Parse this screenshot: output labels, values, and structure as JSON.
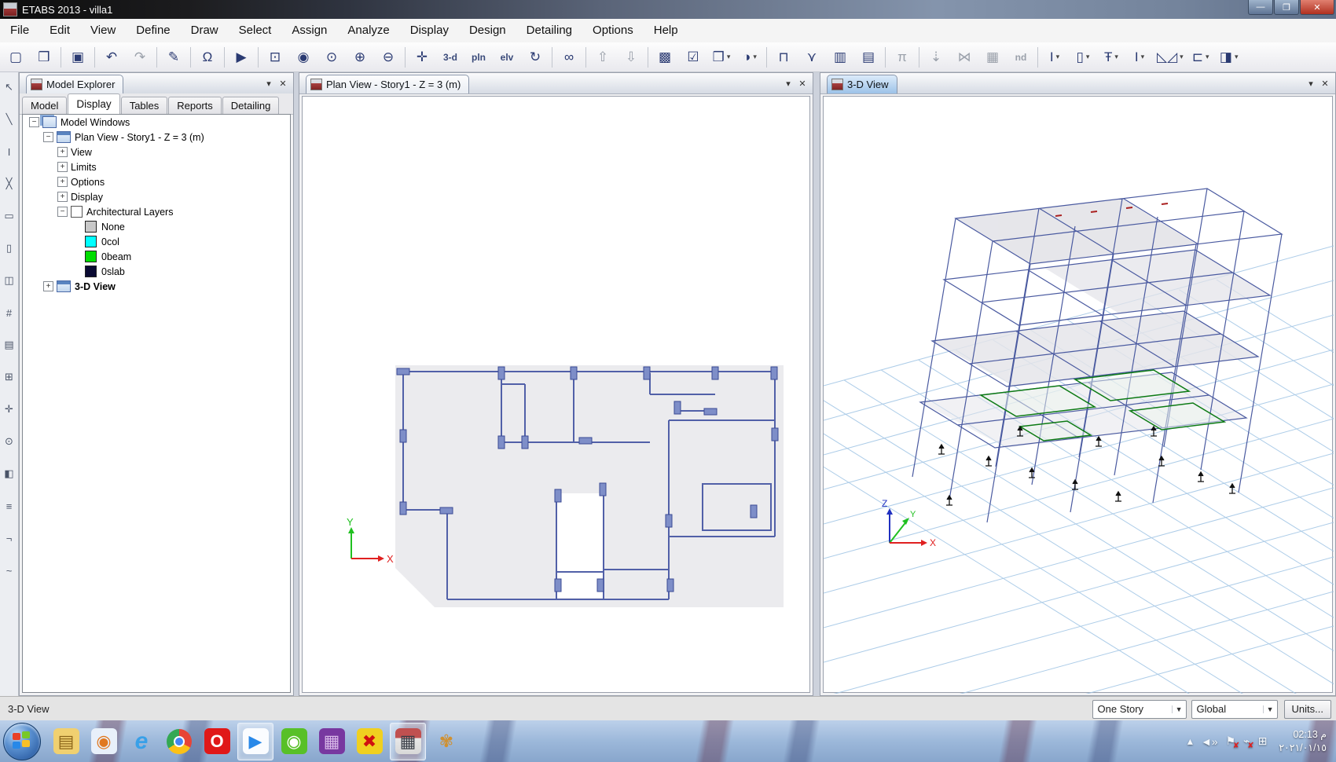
{
  "window": {
    "title": "ETABS 2013  - villa1",
    "controls": {
      "minimize": "—",
      "maximize": "❐",
      "close": "✕"
    }
  },
  "menu": {
    "items": [
      "File",
      "Edit",
      "View",
      "Define",
      "Draw",
      "Select",
      "Assign",
      "Analyze",
      "Display",
      "Design",
      "Detailing",
      "Options",
      "Help"
    ]
  },
  "toolbar": {
    "items": [
      {
        "name": "new-model",
        "glyph": "▢"
      },
      {
        "name": "open-model",
        "glyph": "❒"
      },
      {
        "sep": true
      },
      {
        "name": "save-model",
        "glyph": "▣"
      },
      {
        "sep": true
      },
      {
        "name": "undo",
        "glyph": "↶"
      },
      {
        "name": "redo",
        "glyph": "↷",
        "gray": true
      },
      {
        "sep": true
      },
      {
        "name": "draw-mode",
        "glyph": "✎"
      },
      {
        "sep": true
      },
      {
        "name": "lock-model",
        "glyph": "Ω"
      },
      {
        "sep": true
      },
      {
        "name": "run-analysis",
        "glyph": "▶"
      },
      {
        "sep": true
      },
      {
        "name": "rubber-band-zoom",
        "glyph": "⊡"
      },
      {
        "name": "restore-full-view",
        "glyph": "◉"
      },
      {
        "name": "previous-zoom",
        "glyph": "⊙"
      },
      {
        "name": "zoom-in",
        "glyph": "⊕"
      },
      {
        "name": "zoom-out",
        "glyph": "⊖"
      },
      {
        "sep": true
      },
      {
        "name": "pan-view",
        "glyph": "✛"
      },
      {
        "name": "view-3d",
        "text": "3-d"
      },
      {
        "name": "view-plan",
        "text": "pln"
      },
      {
        "name": "view-elevation",
        "text": "elv"
      },
      {
        "name": "rotate-3d-view",
        "glyph": "↻"
      },
      {
        "sep": true
      },
      {
        "name": "object-view-glasses",
        "glyph": "∞"
      },
      {
        "sep": true
      },
      {
        "name": "move-up-in-list",
        "glyph": "⇧",
        "gray": true
      },
      {
        "name": "move-down-in-list",
        "glyph": "⇩",
        "gray": true
      },
      {
        "sep": true
      },
      {
        "name": "shrink-objects",
        "glyph": "▩"
      },
      {
        "name": "set-display-options",
        "glyph": "☑"
      },
      {
        "name": "object-extrude",
        "glyph": "❒",
        "caret": true
      },
      {
        "name": "object-visibility",
        "glyph": "◑",
        "caret": true
      },
      {
        "sep": true
      },
      {
        "name": "draw-frame-props",
        "glyph": "⊓"
      },
      {
        "name": "snap-options",
        "glyph": "⋎"
      },
      {
        "name": "wall-stack",
        "glyph": "▥"
      },
      {
        "name": "floor-stack",
        "glyph": "▤"
      },
      {
        "sep": true
      },
      {
        "name": "support-assign",
        "glyph": "π",
        "gray": true
      },
      {
        "sep": true
      },
      {
        "name": "load-assign",
        "glyph": "⇣",
        "gray": true
      },
      {
        "name": "mesh-options",
        "glyph": "⋈",
        "gray": true
      },
      {
        "name": "panel-zone",
        "glyph": "▦",
        "gray": true
      },
      {
        "name": "nd-spectrum",
        "text": "nd",
        "gray": true
      },
      {
        "sep": true
      },
      {
        "name": "section-i-beam",
        "glyph": "I",
        "caret": true
      },
      {
        "name": "section-rectangle",
        "glyph": "▯",
        "caret": true
      },
      {
        "name": "section-tee",
        "glyph": "Ŧ",
        "caret": true
      },
      {
        "name": "section-wide-flange",
        "glyph": "Ι",
        "caret": true
      },
      {
        "name": "section-truss",
        "glyph": "◺◿",
        "caret": true
      },
      {
        "name": "section-channel",
        "glyph": "⊏",
        "caret": true
      },
      {
        "name": "section-pier",
        "glyph": "◨",
        "caret": true
      }
    ]
  },
  "side_toolbar": {
    "items": [
      {
        "name": "select-pointer",
        "glyph": "↖"
      },
      {
        "name": "draw-line",
        "glyph": "╲"
      },
      {
        "name": "draw-column",
        "glyph": "Ι"
      },
      {
        "name": "draw-brace",
        "glyph": "╳"
      },
      {
        "name": "draw-floor",
        "glyph": "▭"
      },
      {
        "name": "draw-wall",
        "glyph": "▯"
      },
      {
        "name": "draw-opening",
        "glyph": "◫"
      },
      {
        "name": "draw-grid",
        "glyph": "#"
      },
      {
        "name": "draw-slab",
        "glyph": "▤"
      },
      {
        "name": "quick-draw",
        "glyph": "⊞"
      },
      {
        "name": "draw-link",
        "glyph": "✛"
      },
      {
        "name": "draw-joint",
        "glyph": "⊙"
      },
      {
        "name": "draw-ref-plane",
        "glyph": "◧"
      },
      {
        "name": "draw-dimension",
        "glyph": "≡"
      },
      {
        "name": "draw-section-cut",
        "glyph": "¬"
      },
      {
        "name": "draw-spline",
        "glyph": "~"
      }
    ]
  },
  "model_explorer": {
    "title": "Model Explorer",
    "tabs": [
      {
        "label": "Model",
        "active": false
      },
      {
        "label": "Display",
        "active": true
      },
      {
        "label": "Tables",
        "active": false
      },
      {
        "label": "Reports",
        "active": false
      },
      {
        "label": "Detailing",
        "active": false
      }
    ],
    "tree": [
      {
        "label": "Model Windows",
        "level": 0,
        "exp": "minus",
        "icon": "cascade",
        "bold": false
      },
      {
        "label": "Plan View - Story1 - Z = 3 (m)",
        "level": 1,
        "exp": "minus",
        "icon": "window",
        "bold": false
      },
      {
        "label": "View",
        "level": 2,
        "exp": "plus",
        "bold": false
      },
      {
        "label": "Limits",
        "level": 2,
        "exp": "plus",
        "bold": false
      },
      {
        "label": "Options",
        "level": 2,
        "exp": "plus",
        "bold": false
      },
      {
        "label": "Display",
        "level": 2,
        "exp": "plus",
        "bold": false
      },
      {
        "label": "Architectural Layers",
        "level": 2,
        "exp": "minus",
        "check": true,
        "bold": false
      },
      {
        "label": "None",
        "level": 3,
        "swatch": "#c8c8c8",
        "bold": false
      },
      {
        "label": "0col",
        "level": 3,
        "swatch": "#00ffff",
        "bold": false
      },
      {
        "label": "0beam",
        "level": 3,
        "swatch": "#00dd00",
        "bold": false
      },
      {
        "label": "0slab",
        "level": 3,
        "swatch": "#0a0a32",
        "bold": false
      },
      {
        "label": "3-D View",
        "level": 1,
        "exp": "plus",
        "icon": "window",
        "bold": true
      }
    ]
  },
  "plan_view": {
    "title": "Plan View - Story1 - Z = 3 (m)",
    "axis": {
      "x": "X",
      "y": "Y"
    }
  },
  "three_d_view": {
    "title": "3-D View",
    "axis": {
      "x": "X",
      "y": "Y",
      "z": "Z"
    }
  },
  "panel_controls": {
    "menu_arrow": "▾",
    "close": "✕"
  },
  "status_bar": {
    "left_text": "3-D View",
    "story_selector": "One Story",
    "coord_system": "Global",
    "units_button": "Units...",
    "caret": "▼"
  },
  "taskbar": {
    "apps": [
      {
        "name": "taskbar-explorer",
        "glyph": "▤",
        "bg": "#f0d070",
        "fg": "#8a6418",
        "active": false
      },
      {
        "name": "taskbar-media-player",
        "glyph": "◉",
        "bg": "#e8f0fa",
        "fg": "#e07820",
        "active": false
      },
      {
        "name": "taskbar-internet-explorer",
        "glyph": "e",
        "bg": "transparent",
        "fg": "#38a0e8",
        "active": false
      },
      {
        "name": "taskbar-chrome",
        "chrome": true,
        "active": false
      },
      {
        "name": "taskbar-oracle",
        "glyph": "O",
        "bg": "#e01818",
        "fg": "#ffffff",
        "active": false
      },
      {
        "name": "taskbar-media-play",
        "glyph": "▶",
        "bg": "#fafcff",
        "fg": "#2888e8",
        "active": true
      },
      {
        "name": "taskbar-connectify",
        "glyph": "◉",
        "bg": "#58c028",
        "fg": "#ffffff",
        "active": false
      },
      {
        "name": "taskbar-purple-app",
        "glyph": "▦",
        "bg": "#7838a0",
        "fg": "#d8b8e8",
        "active": false
      },
      {
        "name": "taskbar-crash-tool",
        "glyph": "✖",
        "bg": "#f0d020",
        "fg": "#d01010",
        "active": false
      },
      {
        "name": "taskbar-etabs",
        "glyph": "▦",
        "bg": "linear",
        "fg": "#3a3f48",
        "active": true
      },
      {
        "name": "taskbar-paint",
        "glyph": "✾",
        "bg": "transparent",
        "fg": "#d09030",
        "active": false
      }
    ],
    "tray": [
      {
        "name": "show-hidden-icon",
        "glyph": "▴"
      },
      {
        "name": "volume-icon",
        "glyph": "◄»"
      },
      {
        "name": "action-center-icon",
        "glyph": "⚑",
        "overlay": "✘"
      },
      {
        "name": "power-icon",
        "glyph": "⌁",
        "overlay": "✘"
      },
      {
        "name": "network-icon",
        "glyph": "⊞"
      }
    ],
    "clock": {
      "time": "02:13 م",
      "date": "٢٠٢١/٠١/١٥"
    }
  },
  "colors": {
    "plan_line": "#5160a8",
    "plan_column_fill": "#7e8ec8",
    "slab_gray": "#ebebee",
    "grid_blue": "#9fc4e4",
    "wire_blue": "#4a5aa0",
    "green_layer": "#0c7a14",
    "axis_x_red": "#e02020",
    "axis_y_green": "#20c020",
    "axis_z_blue": "#2030c0"
  }
}
